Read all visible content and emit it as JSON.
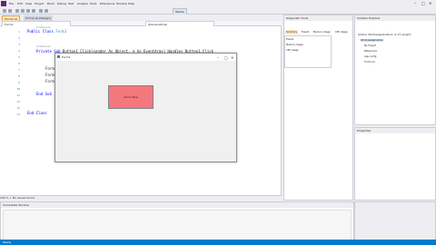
{
  "menus": [
    "File",
    "Edit",
    "View",
    "Project",
    "Build",
    "Debug",
    "Test",
    "Analyze",
    "Tools",
    "Extensions",
    "Window",
    "Help"
  ],
  "toolbar": {
    "start_label": "Start ▸"
  },
  "doctabs": [
    "Form1.vb",
    "Form1.vb [Design]"
  ],
  "navbar": {
    "left": "Form1",
    "right": "(Declarations)"
  },
  "code": {
    "line_numbers": [
      "1",
      "2",
      "3",
      "4",
      "5",
      "6",
      "7",
      "8",
      "9",
      "10",
      "11",
      "12",
      "13",
      "14"
    ],
    "refs_class": "0 references",
    "refs_sub": "0 references",
    "class_open_kw": "Public Class",
    "class_name": "Form1",
    "sub_kw": "Private Sub",
    "sub_sig": "Button1_Click(sender As Object, e As EventArgs) Handles Button1.Click",
    "highlight_a": "Form1",
    "highlight_b": "Form1",
    "highlight_c": "Form1",
    "end_sub": "End Sub",
    "end_class": "End Class"
  },
  "editor_status": "100 %   ✓ No issues found",
  "form": {
    "title": "Form1",
    "button_label": "Click Here"
  },
  "props_panel": {
    "title": "Diagnostic Tools",
    "tabs": [
      "Summary",
      "Events",
      "Memory Usage",
      "CPU Usage"
    ],
    "rows": [
      "Events",
      "Memory Usage",
      "CPU Usage"
    ]
  },
  "solution_explorer": {
    "title": "Solution Explorer",
    "rows": [
      "Solution 'WindowsApplication1' (1 of 1 project)",
      "WindowsApplication",
      "My Project",
      "References",
      "App.config",
      "Form1.vb"
    ]
  },
  "properties": {
    "title": "Properties"
  },
  "bottom": {
    "title": "Immediate Window"
  },
  "status": {
    "text": "Ready"
  },
  "colors": {
    "accent": "#007acc",
    "button_fill": "#f5777e",
    "vs_purple": "#68217a"
  }
}
